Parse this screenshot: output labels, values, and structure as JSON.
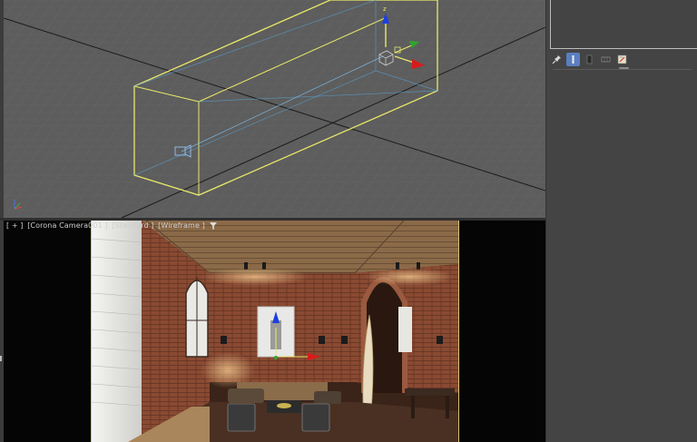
{
  "viewport_bottom": {
    "label_parts": [
      "[ + ]",
      "[Corona Camera001 ]",
      "[Standard ]",
      "[Wireframe ]"
    ]
  },
  "axis_labels": {
    "z": "z"
  },
  "colors": {
    "selection_box": "#e8e86a",
    "viewport_bg": "#5d5d5d",
    "axis_x": "#d81b1b",
    "axis_y": "#2fa52f",
    "axis_z": "#1d3fe0",
    "safe_frame": "#d7c27a",
    "active_tab": "#5a7fc0"
  },
  "command_panel": {
    "tabs": [
      {
        "icon": "pin-icon",
        "active": false
      },
      {
        "icon": "modifier-stack-icon",
        "active": true
      },
      {
        "icon": "make-unique-icon",
        "active": false
      },
      {
        "icon": "remove-modifier-icon",
        "active": false
      },
      {
        "icon": "configure-modifier-sets-icon",
        "active": false
      }
    ]
  }
}
